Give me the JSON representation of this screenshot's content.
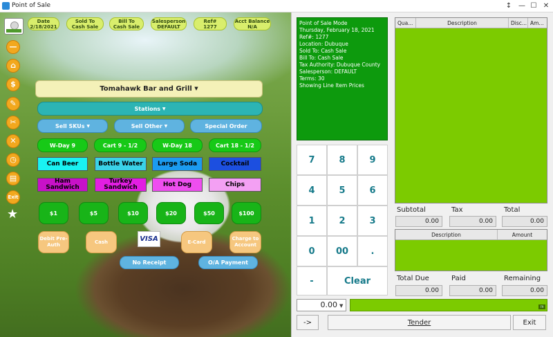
{
  "window": {
    "title": "Point of Sale",
    "buttons": {
      "restore": "↕",
      "minimize": "—",
      "maximize": "☐",
      "close": "✕"
    }
  },
  "header_pills": [
    {
      "line1": "Date",
      "line2": "2/18/2021"
    },
    {
      "line1": "Sold To",
      "line2": "Cash Sale"
    },
    {
      "line1": "Bill To",
      "line2": "Cash Sale"
    },
    {
      "line1": "Salesperson",
      "line2": "DEFAULT"
    },
    {
      "line1": "Ref#",
      "line2": "1277"
    },
    {
      "line1": "Acct Balance",
      "line2": "N/A"
    }
  ],
  "toolbar": {
    "minus_label": "—",
    "home_label": "⌂",
    "bag_label": "$",
    "wrench_label": "✎",
    "scissors_label": "✂",
    "cancel_label": "✕",
    "clock_label": "◷",
    "register_label": "▤",
    "exit_label": "Exit",
    "star_label": "★"
  },
  "location_dropdown": {
    "label": "Tomahawk Bar and Grill",
    "caret": "▼"
  },
  "stations_dropdown": {
    "label": "Stations",
    "caret": "▼"
  },
  "row_sell": [
    {
      "label": "Sell SKUs",
      "caret": "▼"
    },
    {
      "label": "Sell Other",
      "caret": "▼"
    },
    {
      "label": "Special Order",
      "caret": ""
    }
  ],
  "row_greens": [
    "W-Day 9",
    "Cart 9 - 1/2",
    "W-Day 18",
    "Cart 18 - 1/2"
  ],
  "row_drinks": [
    {
      "label": "Can Beer",
      "color": "#19f2f2"
    },
    {
      "label": "Bottle Water",
      "color": "#3ad2e8"
    },
    {
      "label": "Large Soda",
      "color": "#1b9bf0"
    },
    {
      "label": "Cocktail",
      "color": "#1c4fe0"
    }
  ],
  "row_food": [
    {
      "label": "Ham Sandwich",
      "color": "#c811c8"
    },
    {
      "label": "Turkey Sandwich",
      "color": "#e21ee2"
    },
    {
      "label": "Hot Dog",
      "color": "#ef4ef0"
    },
    {
      "label": "Chips",
      "color": "#f3a0f3"
    }
  ],
  "cash_buttons": [
    "$1",
    "$5",
    "$10",
    "$20",
    "$50",
    "$100"
  ],
  "tender_buttons": {
    "debit": "Debit Pre-Auth",
    "cash": "Cash",
    "visa": "VISA",
    "ecard": "E-Card",
    "charge": "Charge to Account"
  },
  "no_receipt": "No Receipt",
  "oa_payment": "O/A Payment",
  "info": [
    "Point of Sale Mode",
    "Thursday, February 18, 2021",
    "Ref#: 1277",
    "Location: Dubuque",
    "Sold To: Cash Sale",
    "Bill To: Cash Sale",
    "Tax Authority: Dubuque County",
    "Salesperson: DEFAULT",
    "Terms: 30",
    "Showing Line Item Prices"
  ],
  "items_grid": {
    "columns": [
      "Qua...",
      "Description",
      "Disc...",
      "Am..."
    ]
  },
  "keypad": [
    "7",
    "8",
    "9",
    "4",
    "5",
    "6",
    "1",
    "2",
    "3",
    "0",
    "00",
    ".",
    "-",
    "Clear"
  ],
  "totals": {
    "subtotal_label": "Subtotal",
    "subtotal": "0.00",
    "tax_label": "Tax",
    "tax": "0.00",
    "total_label": "Total",
    "total": "0.00"
  },
  "payments_grid": {
    "columns": [
      "Description",
      "Amount"
    ]
  },
  "due": {
    "total_due_label": "Total Due",
    "total_due": "0.00",
    "paid_label": "Paid",
    "paid": "0.00",
    "remaining_label": "Remaining",
    "remaining": "0.00"
  },
  "amount_entry": {
    "value": "0.00",
    "spin": "▼",
    "corner": "F9"
  },
  "bottom": {
    "arrow": "->",
    "tender": "Tender",
    "exit": "Exit"
  }
}
